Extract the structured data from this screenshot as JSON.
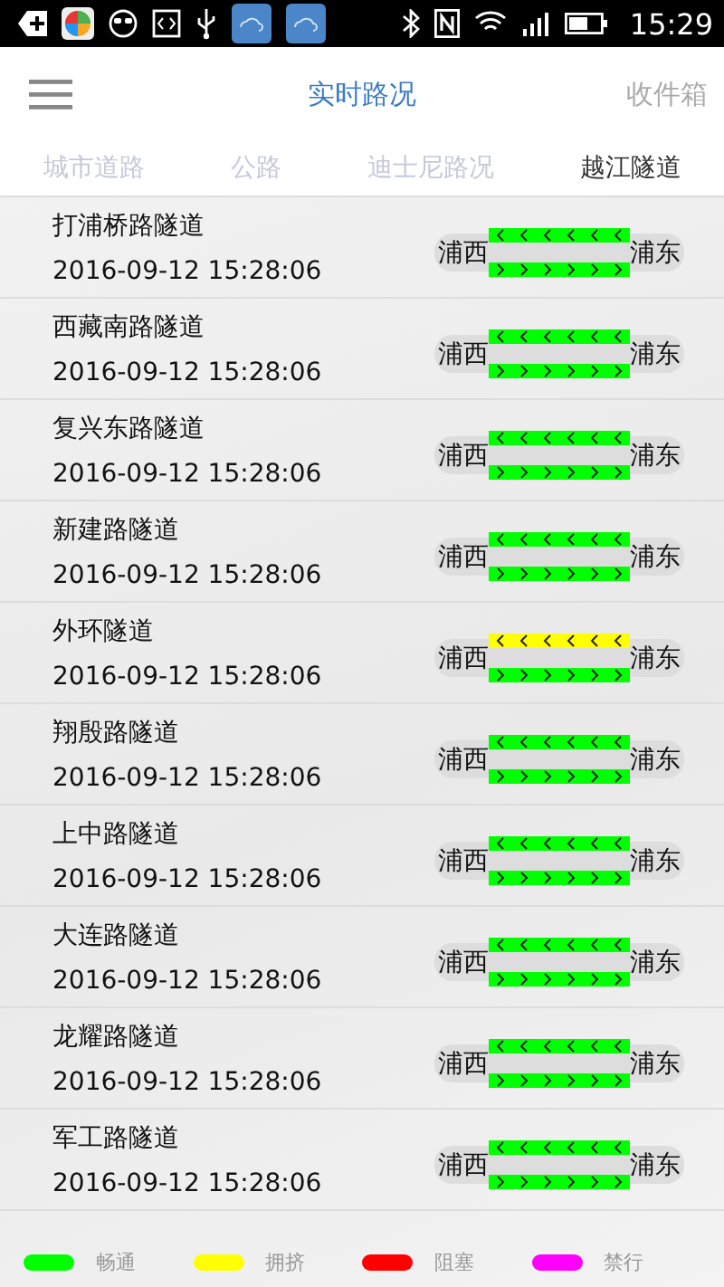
{
  "status_bar": {
    "time": "15:29"
  },
  "header": {
    "title": "实时路况",
    "action": "收件箱"
  },
  "tabs": [
    {
      "label": "城市道路",
      "selected": false
    },
    {
      "label": "公路",
      "selected": false
    },
    {
      "label": "迪士尼路况",
      "selected": false
    },
    {
      "label": "越江隧道",
      "selected": true
    }
  ],
  "tunnels": [
    {
      "name": "打浦桥路隧道",
      "time": "2016-09-12 15:28:06",
      "west": "浦西",
      "east": "浦东",
      "lanes": [
        {
          "kind": "westbound",
          "color": "#00ff00"
        },
        {
          "kind": "eastbound",
          "color": "#00ff00"
        }
      ]
    },
    {
      "name": "西藏南路隧道",
      "time": "2016-09-12 15:28:06",
      "west": "浦西",
      "east": "浦东",
      "lanes": [
        {
          "kind": "westbound",
          "color": "#00ff00"
        },
        {
          "kind": "eastbound",
          "color": "#00ff00"
        }
      ]
    },
    {
      "name": "复兴东路隧道",
      "time": "2016-09-12 15:28:06",
      "west": "浦西",
      "east": "浦东",
      "lanes": [
        {
          "kind": "westbound",
          "color": "#00ff00"
        },
        {
          "kind": "eastbound",
          "color": "#00ff00"
        }
      ]
    },
    {
      "name": "新建路隧道",
      "time": "2016-09-12 15:28:06",
      "west": "浦西",
      "east": "浦东",
      "lanes": [
        {
          "kind": "westbound",
          "color": "#00ff00"
        },
        {
          "kind": "eastbound",
          "color": "#00ff00"
        }
      ]
    },
    {
      "name": "外环隧道",
      "time": "2016-09-12 15:28:06",
      "west": "浦西",
      "east": "浦东",
      "lanes": [
        {
          "kind": "westbound",
          "color": "#ffff00"
        },
        {
          "kind": "eastbound",
          "color": "#00ff00"
        }
      ]
    },
    {
      "name": "翔殷路隧道",
      "time": "2016-09-12 15:28:06",
      "west": "浦西",
      "east": "浦东",
      "lanes": [
        {
          "kind": "westbound",
          "color": "#00ff00"
        },
        {
          "kind": "eastbound",
          "color": "#00ff00"
        }
      ]
    },
    {
      "name": "上中路隧道",
      "time": "2016-09-12 15:28:06",
      "west": "浦西",
      "east": "浦东",
      "lanes": [
        {
          "kind": "westbound",
          "color": "#00ff00"
        },
        {
          "kind": "eastbound",
          "color": "#00ff00"
        }
      ]
    },
    {
      "name": "大连路隧道",
      "time": "2016-09-12 15:28:06",
      "west": "浦西",
      "east": "浦东",
      "lanes": [
        {
          "kind": "westbound",
          "color": "#00ff00"
        },
        {
          "kind": "eastbound",
          "color": "#00ff00"
        }
      ]
    },
    {
      "name": "龙耀路隧道",
      "time": "2016-09-12 15:28:06",
      "west": "浦西",
      "east": "浦东",
      "lanes": [
        {
          "kind": "westbound",
          "color": "#00ff00"
        },
        {
          "kind": "eastbound",
          "color": "#00ff00"
        }
      ]
    },
    {
      "name": "军工路隧道",
      "time": "2016-09-12 15:28:06",
      "west": "浦西",
      "east": "浦东",
      "lanes": [
        {
          "kind": "westbound",
          "color": "#00ff00"
        },
        {
          "kind": "eastbound",
          "color": "#00ff00"
        }
      ]
    }
  ],
  "legend": [
    {
      "label": "畅通",
      "color": "#00ff00"
    },
    {
      "label": "拥挤",
      "color": "#ffff00"
    },
    {
      "label": "阻塞",
      "color": "#ff0000"
    },
    {
      "label": "禁行",
      "color": "#ff00ff"
    }
  ]
}
